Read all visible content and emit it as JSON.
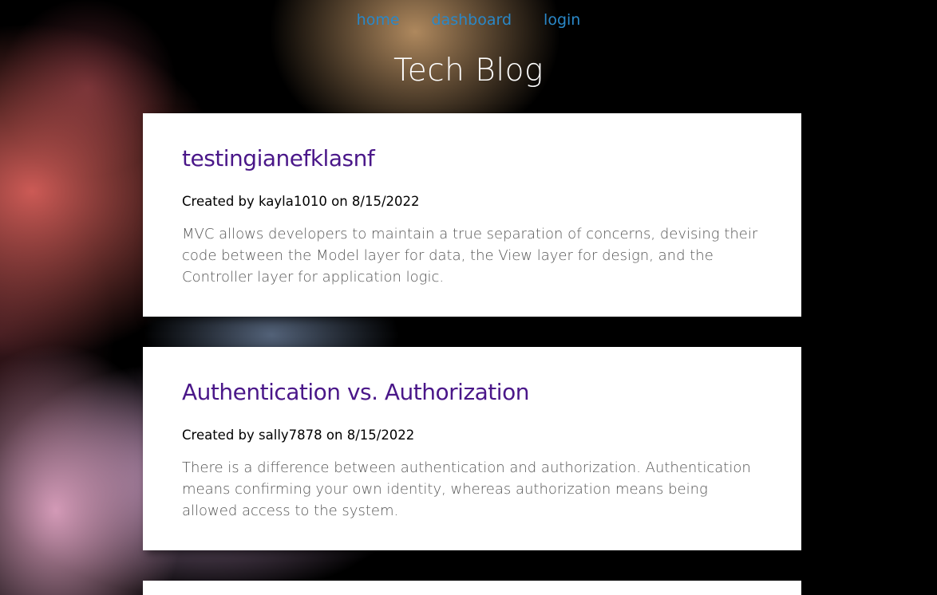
{
  "nav": {
    "items": [
      {
        "label": "home"
      },
      {
        "label": "dashboard"
      },
      {
        "label": "login"
      }
    ]
  },
  "site": {
    "title": "Tech Blog"
  },
  "posts": [
    {
      "title": "testingianefklasnf",
      "meta": "Created by kayla1010 on 8/15/2022",
      "body": "MVC allows developers to maintain a true separation of concerns, devising their code between the Model layer for data, the View layer for design, and the Controller layer for application logic."
    },
    {
      "title": "Authentication vs. Authorization",
      "meta": "Created by sally7878 on 8/15/2022",
      "body": "There is a difference between authentication and authorization. Authentication means confirming your own identity, whereas authorization means being allowed access to the system."
    }
  ],
  "colors": {
    "nav_link": "#2a88c8",
    "post_title": "#4a1789",
    "page_background": "#000000",
    "card_background": "#ffffff"
  }
}
